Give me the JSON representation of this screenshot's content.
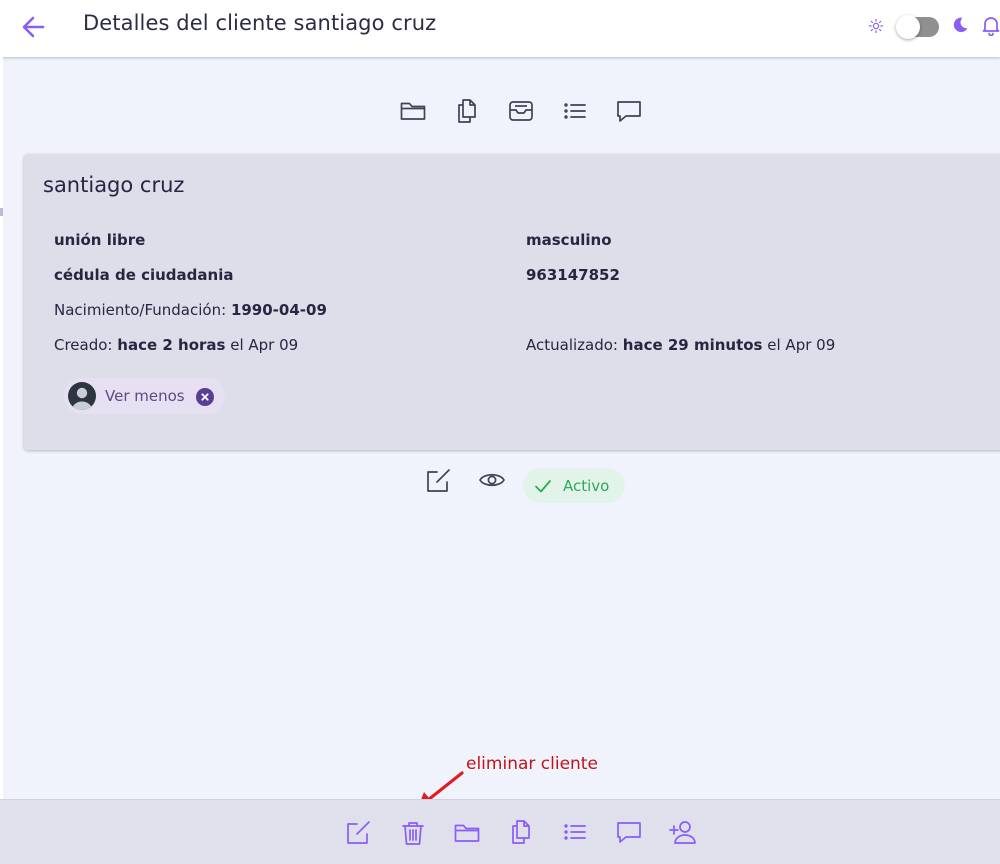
{
  "header": {
    "title": "Detalles del cliente santiago cruz",
    "theme_toggle": "light"
  },
  "client": {
    "name": "santiago cruz",
    "marital_status": "unión libre",
    "gender": "masculino",
    "document_type": "cédula de ciudadania",
    "document_number": "963147852",
    "birth_label": "Nacimiento/Fundación:",
    "birth_date": "1990-04-09",
    "created_label": "Creado:",
    "created_rel": "hace 2 horas",
    "created_date": "el Apr 09",
    "updated_label": "Actualizado:",
    "updated_rel": "hace 29 minutos",
    "updated_date": "el Apr 09",
    "toggle_chip_label": "Ver menos"
  },
  "status": {
    "label": "Activo"
  },
  "annotation": {
    "text": "eliminar cliente"
  },
  "icons": {
    "top": [
      "folder-icon",
      "documents-icon",
      "inbox-icon",
      "list-icon",
      "comment-icon"
    ],
    "card_actions": [
      "edit-icon",
      "view-icon"
    ],
    "bottom": [
      "edit-icon",
      "trash-icon",
      "folder-icon",
      "documents-icon",
      "list-icon",
      "comment-icon",
      "add-user-icon"
    ]
  },
  "colors": {
    "accent": "#8b5cf6",
    "icon_dark": "#3c4456",
    "card_bg": "#dddeea",
    "page_bg": "#f0f3fc",
    "active_green": "#2fa85a",
    "annotation_red": "#c0141c"
  }
}
